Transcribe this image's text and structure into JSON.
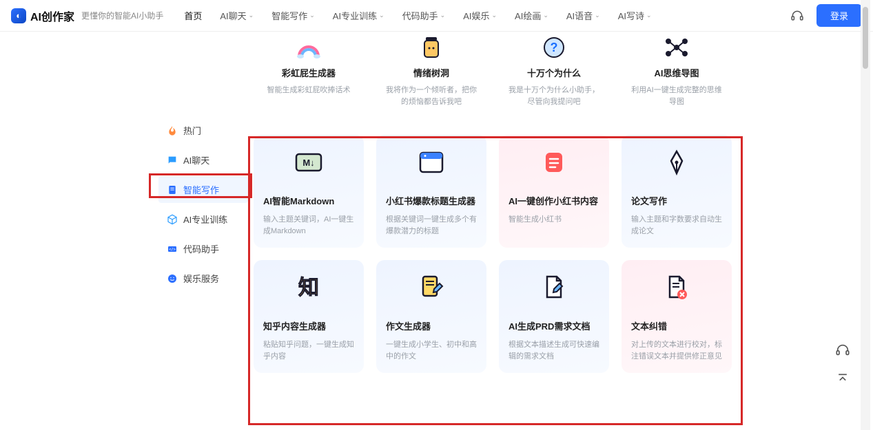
{
  "header": {
    "logo": "AI创作家",
    "tagline": "更懂你的智能AI小助手",
    "nav": [
      "首页",
      "AI聊天",
      "智能写作",
      "AI专业训练",
      "代码助手",
      "AI娱乐",
      "AI绘画",
      "AI语音",
      "AI写诗"
    ],
    "nav_has_chevron": [
      false,
      true,
      true,
      true,
      true,
      true,
      true,
      true,
      true
    ],
    "login": "登录"
  },
  "sidebar": {
    "items": [
      {
        "icon": "fire",
        "label": "热门",
        "color": "#ff8a3d"
      },
      {
        "icon": "chat",
        "label": "AI聊天",
        "color": "#2b9cff"
      },
      {
        "icon": "doc",
        "label": "智能写作",
        "color": "#2b6fff"
      },
      {
        "icon": "cube",
        "label": "AI专业训练",
        "color": "#2b9cff"
      },
      {
        "icon": "code",
        "label": "代码助手",
        "color": "#2b6fff"
      },
      {
        "icon": "smile",
        "label": "娱乐服务",
        "color": "#2b6fff"
      }
    ],
    "selected_index": 2
  },
  "top_row": [
    {
      "icon": "rainbow",
      "title": "彩虹屁生成器",
      "desc": "智能生成彩虹屁吹捧话术"
    },
    {
      "icon": "jar",
      "title": "情绪树洞",
      "desc": "我将作为一个倾听者，把你的烦恼都告诉我吧"
    },
    {
      "icon": "question",
      "title": "十万个为什么",
      "desc": "我是十万个为什么小助手，尽管向我提问吧"
    },
    {
      "icon": "mindmap",
      "title": "AI思维导图",
      "desc": "利用AI一键生成完整的思维导图"
    }
  ],
  "grid": [
    {
      "bg": "blue",
      "icon": "markdown",
      "title": "AI智能Markdown",
      "desc": "输入主题关键词，AI一键生成Markdown"
    },
    {
      "bg": "blue",
      "icon": "window",
      "title": "小红书爆款标题生成器",
      "desc": "根据关键词一键生成多个有爆款潜力的标题"
    },
    {
      "bg": "pink",
      "icon": "note",
      "title": "AI一键创作小红书内容",
      "desc": "智能生成小红书"
    },
    {
      "bg": "blue",
      "icon": "pen",
      "title": "论文写作",
      "desc": "输入主题和字数要求自动生成论文"
    },
    {
      "bg": "blue",
      "icon": "zhi",
      "title": "知乎内容生成器",
      "desc": "粘贴知乎问题，一键生成知乎内容"
    },
    {
      "bg": "blue",
      "icon": "docpen",
      "title": "作文生成器",
      "desc": "一键生成小学生、初中和高中的作文"
    },
    {
      "bg": "blue",
      "icon": "filepen",
      "title": "AI生成PRD需求文档",
      "desc": "根据文本描述生成可快速编辑的需求文档"
    },
    {
      "bg": "pink",
      "icon": "fileerr",
      "title": "文本纠错",
      "desc": "对上传的文本进行校对，标注错误文本并提供修正意见"
    }
  ]
}
